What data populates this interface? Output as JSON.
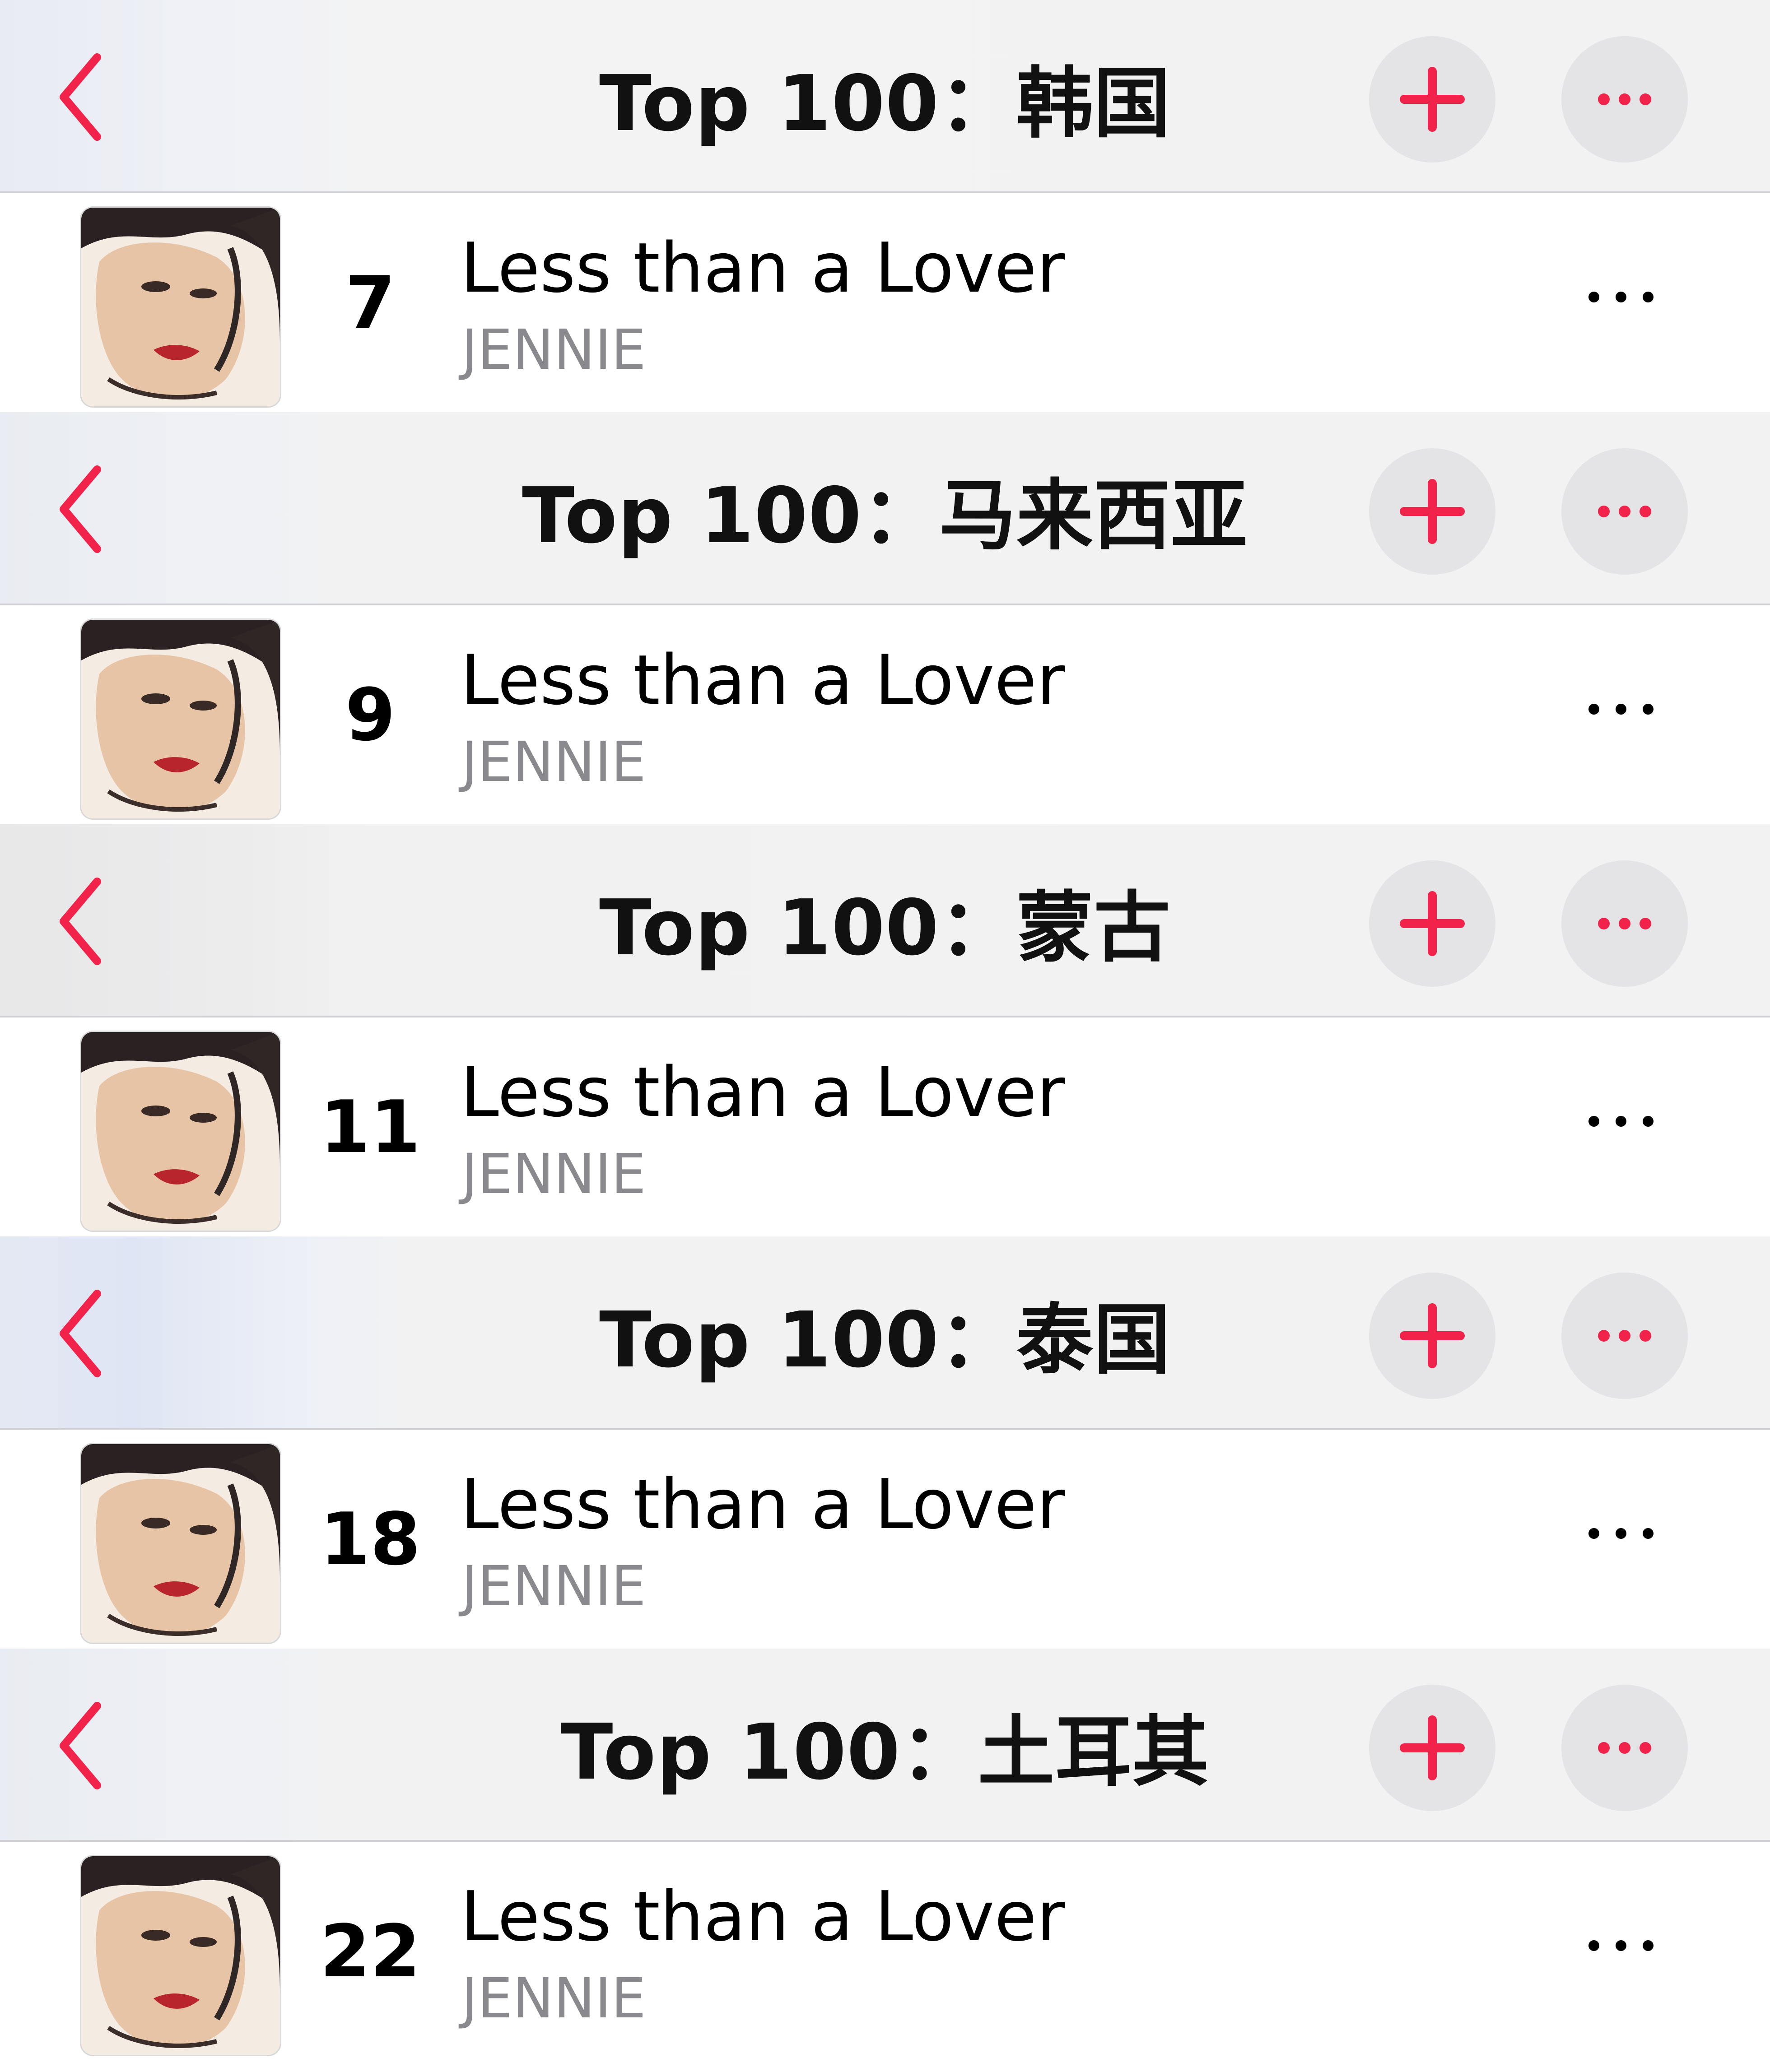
{
  "colors": {
    "accent": "#f2234a",
    "header_bg": "#f2f2f2",
    "button_bg": "#e4e4e6",
    "title_text": "#111111",
    "secondary_text": "#8a8a8e"
  },
  "icons": {
    "back": "chevron-left-icon",
    "add": "plus-icon",
    "more": "ellipsis-icon"
  },
  "sections": [
    {
      "title": "Top 100：韩国",
      "rank": "7",
      "song": "Less than a Lover",
      "artist": "JENNIE"
    },
    {
      "title": "Top 100：马来西亚",
      "rank": "9",
      "song": "Less than a Lover",
      "artist": "JENNIE"
    },
    {
      "title": "Top 100：蒙古",
      "rank": "11",
      "song": "Less than a Lover",
      "artist": "JENNIE"
    },
    {
      "title": "Top 100：泰国",
      "rank": "18",
      "song": "Less than a Lover",
      "artist": "JENNIE"
    },
    {
      "title": "Top 100：土耳其",
      "rank": "22",
      "song": "Less than a Lover",
      "artist": "JENNIE"
    }
  ]
}
